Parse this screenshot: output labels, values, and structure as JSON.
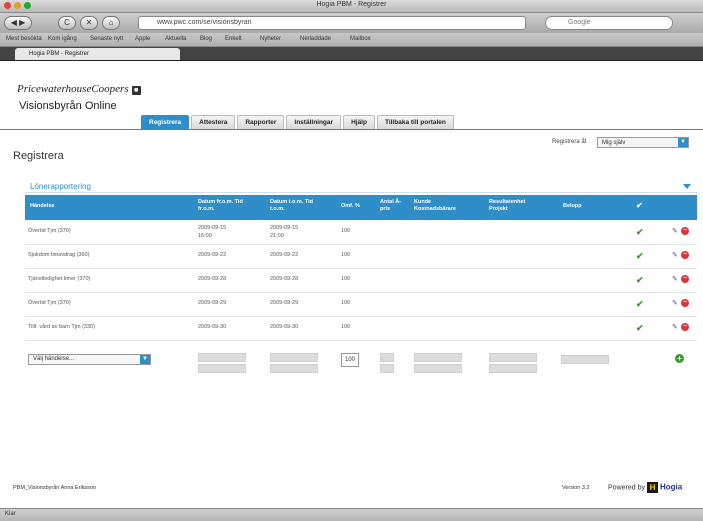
{
  "browser": {
    "window_title": "Hogia PBM - Registrer",
    "url": "www.pwc.com/se/visionsbyran",
    "search_placeholder": "Google",
    "tab_label": "Hogia PBM - Registrer",
    "bookmarks": [
      "Mest besökta",
      "Kom igång",
      "Senaste nytt",
      "Apple",
      "Aktuella",
      "Blog",
      "Enkelt",
      "Nyheter",
      "Nerladdade",
      "Mailbox"
    ],
    "status": "Klar",
    "nav": {
      "back": "◀",
      "forward": "▶",
      "reload": "C",
      "stop": "✕",
      "home": "⌂"
    }
  },
  "header": {
    "logo_text": "PricewaterhouseCoopers",
    "logo_badge": "■",
    "subtitle": "Visionsbyrån Online"
  },
  "nav": {
    "tabs": [
      {
        "label": "Registrera",
        "active": true
      },
      {
        "label": "Attestera",
        "active": false
      },
      {
        "label": "Rapporter",
        "active": false
      },
      {
        "label": "Inställningar",
        "active": false
      },
      {
        "label": "Hjälp",
        "active": false
      },
      {
        "label": "Tillbaka till portalen",
        "active": false
      }
    ]
  },
  "page": {
    "title": "Registrera",
    "register_as_label": "Registrera åt",
    "register_as_value": "Mig själv",
    "section_title": "Lönerapportering"
  },
  "table": {
    "headers": [
      "Händelse",
      "Datum fr.o.m. Tid fr.o.m.",
      "Datum t.o.m. Tid t.o.m.",
      "Omf. %",
      "Antal Å-pris",
      "Kunde Kostnadsbärare",
      "Resultatenhet Projekt",
      "Belopp"
    ],
    "rows": [
      {
        "event": "Övertid Tjm (370)",
        "from": "2009-09-15",
        "from_time": "16:00",
        "to": "2009-09-15",
        "to_time": "21:00",
        "pct": "100"
      },
      {
        "event": "Sjukdom timavdrag (360)",
        "from": "2009-09-22",
        "from_time": "",
        "to": "2009-09-22",
        "to_time": "",
        "pct": "100"
      },
      {
        "event": "Tjänstledighet timer (370)",
        "from": "2009-09-28",
        "from_time": "",
        "to": "2009-09-28",
        "to_time": "",
        "pct": "100"
      },
      {
        "event": "Övertid Tjm (370)",
        "from": "2009-09-29",
        "from_time": "",
        "to": "2009-09-29",
        "to_time": "",
        "pct": "100"
      },
      {
        "event": "Tillf. vård av barn Tjm (330)",
        "from": "2009-09-30",
        "from_time": "",
        "to": "2009-09-30",
        "to_time": "",
        "pct": "100"
      }
    ],
    "new_row": {
      "event_placeholder": "Välj händelse...",
      "pct": "100"
    }
  },
  "footer": {
    "left": "PBM_Visionsbyrån  Anna Eriksson",
    "version": "Version 3.2",
    "powered": "Powered by",
    "brand": "Hogia"
  },
  "colors": {
    "accent": "#2f8ec8",
    "ok": "#3a9a2a",
    "delete": "#d33333"
  }
}
